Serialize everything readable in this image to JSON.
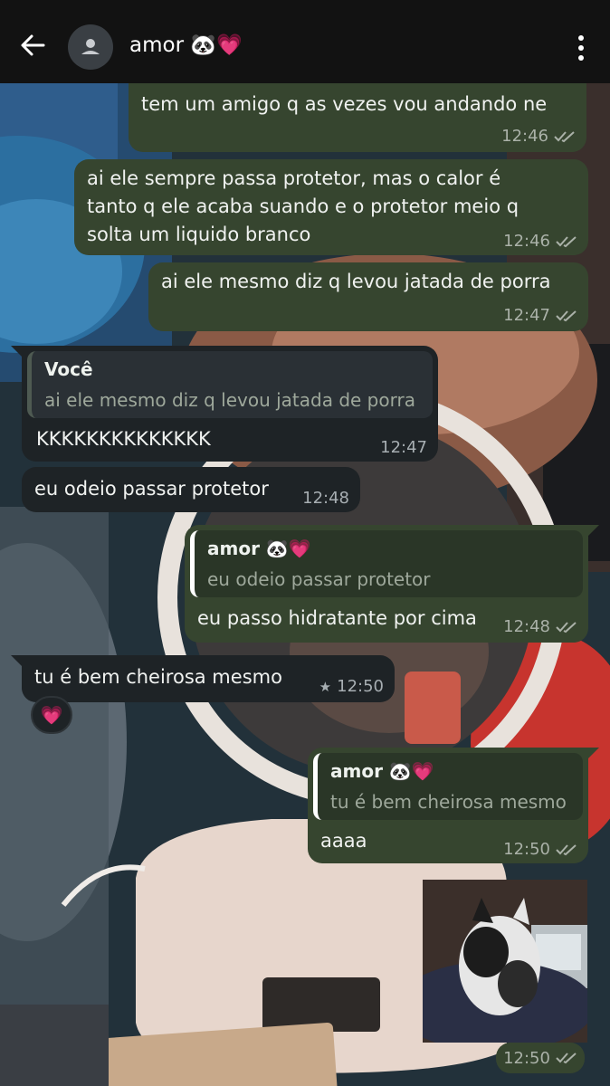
{
  "header": {
    "contact_name": "amor 🐼💗"
  },
  "messages": [
    {
      "direction": "out",
      "text": "tem um amigo q as vezes vou andando ne",
      "time": "12:46",
      "status": "read"
    },
    {
      "direction": "out",
      "lines": [
        "ai ele sempre passa protetor, mas o calor é",
        "tanto q ele acaba suando e o protetor meio q",
        "solta um liquido branco"
      ],
      "time": "12:46",
      "status": "read"
    },
    {
      "direction": "out",
      "text": "ai ele mesmo diz q levou jatada de porra",
      "time": "12:47",
      "status": "read"
    },
    {
      "direction": "in",
      "quote": {
        "author": "Você",
        "text": "ai ele mesmo diz q levou jatada de porra"
      },
      "text": "KKKKKKKKKKKKKK",
      "time": "12:47"
    },
    {
      "direction": "in",
      "text": "eu odeio passar protetor",
      "time": "12:48"
    },
    {
      "direction": "out",
      "quote": {
        "author": "amor 🐼💗",
        "text": "eu odeio passar protetor"
      },
      "text": "eu passo hidratante por cima",
      "time": "12:48",
      "status": "read"
    },
    {
      "direction": "in",
      "text": "tu é bem cheirosa mesmo",
      "time": "12:50",
      "starred": true,
      "star": "★",
      "reaction": "💗"
    },
    {
      "direction": "out",
      "quote": {
        "author": "amor 🐼💗",
        "text": "tu é bem cheirosa mesmo"
      },
      "text": "aaaa",
      "time": "12:50",
      "status": "read"
    },
    {
      "direction": "out",
      "type": "image",
      "time": "12:50",
      "status": "read"
    }
  ],
  "icons": {
    "back": "arrow-left-icon",
    "avatar": "person-icon",
    "menu": "more-vert-icon",
    "read": "double-check-icon",
    "star": "star-icon"
  },
  "colors": {
    "outgoing_bubble": "#36452f",
    "incoming_bubble": "#1e2326",
    "header": "#121212"
  }
}
